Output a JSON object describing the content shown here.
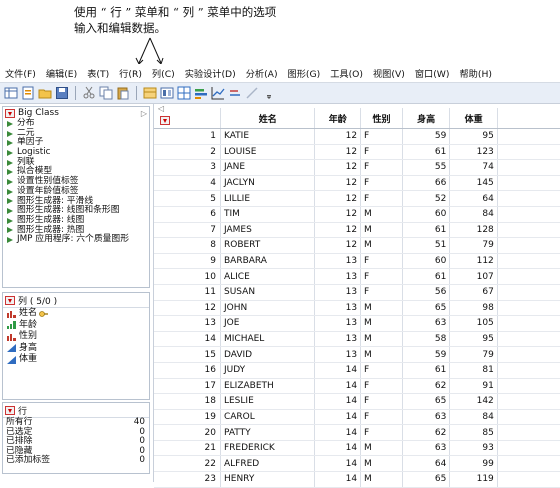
{
  "annotation": {
    "line1": "使用 “ 行 ” 菜单和 “ 列 ” 菜单中的选项",
    "line2": "输入和编辑数据。"
  },
  "menubar": [
    "文件(F)",
    "编辑(E)",
    "表(T)",
    "行(R)",
    "列(C)",
    "实验设计(D)",
    "分析(A)",
    "图形(G)",
    "工具(O)",
    "视图(V)",
    "窗口(W)",
    "帮助(H)"
  ],
  "table_panel": {
    "title": "Big Class",
    "scripts": [
      "分布",
      "二元",
      "单因子",
      "Logistic",
      "列联",
      "拟合模型",
      "设置性别值标签",
      "设置年龄值标签",
      "图形生成器: 平滑线",
      "图形生成器: 线图和条形图",
      "图形生成器: 线图",
      "图形生成器: 热图",
      "JMP 应用程序: 六个质量图形"
    ]
  },
  "columns_panel": {
    "title": "列 ( 5/0 )",
    "columns": [
      {
        "name": "姓名",
        "icon": "nominal-icon",
        "tag": "key-icon"
      },
      {
        "name": "年龄",
        "icon": "ordinal-icon"
      },
      {
        "name": "性别",
        "icon": "nominal-icon"
      },
      {
        "name": "身高",
        "icon": "continuous-icon"
      },
      {
        "name": "体重",
        "icon": "continuous-icon"
      }
    ]
  },
  "rows_panel": {
    "title": "行",
    "items": [
      {
        "label": "所有行",
        "value": "40"
      },
      {
        "label": "已选定",
        "value": "0"
      },
      {
        "label": "已排除",
        "value": "0"
      },
      {
        "label": "已隐藏",
        "value": "0"
      },
      {
        "label": "已添加标签",
        "value": "0"
      }
    ]
  },
  "grid": {
    "headers": [
      "姓名",
      "年龄",
      "性别",
      "身高",
      "体重"
    ],
    "rows": [
      [
        "1",
        "KATIE",
        "12",
        "F",
        "59",
        "95"
      ],
      [
        "2",
        "LOUISE",
        "12",
        "F",
        "61",
        "123"
      ],
      [
        "3",
        "JANE",
        "12",
        "F",
        "55",
        "74"
      ],
      [
        "4",
        "JACLYN",
        "12",
        "F",
        "66",
        "145"
      ],
      [
        "5",
        "LILLIE",
        "12",
        "F",
        "52",
        "64"
      ],
      [
        "6",
        "TIM",
        "12",
        "M",
        "60",
        "84"
      ],
      [
        "7",
        "JAMES",
        "12",
        "M",
        "61",
        "128"
      ],
      [
        "8",
        "ROBERT",
        "12",
        "M",
        "51",
        "79"
      ],
      [
        "9",
        "BARBARA",
        "13",
        "F",
        "60",
        "112"
      ],
      [
        "10",
        "ALICE",
        "13",
        "F",
        "61",
        "107"
      ],
      [
        "11",
        "SUSAN",
        "13",
        "F",
        "56",
        "67"
      ],
      [
        "12",
        "JOHN",
        "13",
        "M",
        "65",
        "98"
      ],
      [
        "13",
        "JOE",
        "13",
        "M",
        "63",
        "105"
      ],
      [
        "14",
        "MICHAEL",
        "13",
        "M",
        "58",
        "95"
      ],
      [
        "15",
        "DAVID",
        "13",
        "M",
        "59",
        "79"
      ],
      [
        "16",
        "JUDY",
        "14",
        "F",
        "61",
        "81"
      ],
      [
        "17",
        "ELIZABETH",
        "14",
        "F",
        "62",
        "91"
      ],
      [
        "18",
        "LESLIE",
        "14",
        "F",
        "65",
        "142"
      ],
      [
        "19",
        "CAROL",
        "14",
        "F",
        "63",
        "84"
      ],
      [
        "20",
        "PATTY",
        "14",
        "F",
        "62",
        "85"
      ],
      [
        "21",
        "FREDERICK",
        "14",
        "M",
        "63",
        "93"
      ],
      [
        "22",
        "ALFRED",
        "14",
        "M",
        "64",
        "99"
      ],
      [
        "23",
        "HENRY",
        "14",
        "M",
        "65",
        "119"
      ]
    ]
  },
  "colors": {
    "accent": "#c00000",
    "toolbar": "#e8eef7",
    "script_green": "#3a8a3a"
  }
}
